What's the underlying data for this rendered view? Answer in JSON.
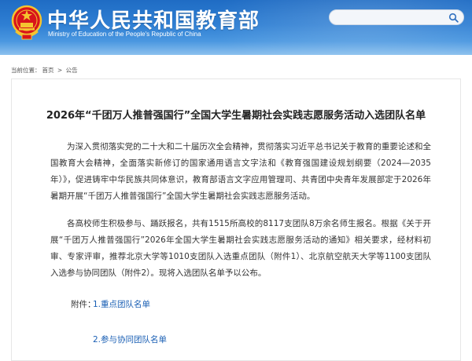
{
  "header": {
    "title": "中华人民共和国教育部",
    "subtitle": "Ministry of Education of the People's Republic of China",
    "emblem_icon": "national-emblem-icon",
    "colors": {
      "banner_top": "#1f6cc4",
      "banner_bottom": "#8cc1ee",
      "title": "#ffffff"
    }
  },
  "search": {
    "placeholder": "",
    "icon": "search-icon"
  },
  "breadcrumb": {
    "prefix": "当前位置：",
    "items": [
      "首页",
      "公告"
    ],
    "separator": ">"
  },
  "article": {
    "title": "2026年“千团万人推普强国行”全国大学生暑期社会实践志愿服务活动入选团队名单",
    "paragraphs": [
      "为深入贯彻落实党的二十大和二十届历次全会精神，贯彻落实习近平总书记关于教育的重要论述和全国教育大会精神，全面落实新修订的国家通用语言文字法和《教育强国建设规划纲要（2024—2035年）》，促进铸牢中华民族共同体意识，教育部语言文字应用管理司、共青团中央青年发展部定于2026年暑期开展“千团万人推普强国行”全国大学生暑期社会实践志愿服务活动。",
      "各高校师生积极参与、踊跃报名，共有1515所高校的8117支团队8万余名师生报名。根据《关于开展“千团万人推普强国行”2026年全国大学生暑期社会实践志愿服务活动的通知》相关要求，经材料初审、专家评审，推荐北京大学等1010支团队入选重点团队（附件1）、北京航空航天大学等1100支团队入选参与协同团队（附件2）。现将入选团队名单予以公布。"
    ],
    "attachments_label": "附件：",
    "attachments": [
      {
        "prefix": "1.",
        "label": "重点团队名单"
      },
      {
        "prefix": "2.",
        "label": "参与协同团队名单"
      }
    ],
    "link_color": "#1a5fb4"
  }
}
